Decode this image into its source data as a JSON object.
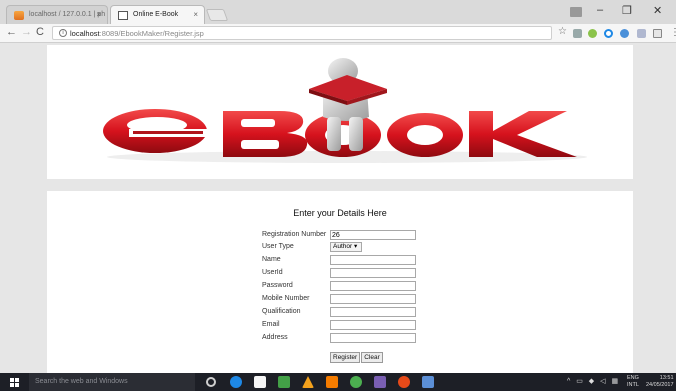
{
  "browser": {
    "tabs": [
      {
        "title": "localhost / 127.0.0.1 | ph"
      },
      {
        "title": "Online E-Book"
      }
    ],
    "tab_close": "×",
    "address_bar": {
      "host": "localhost",
      "path": ":8089/EbookMaker/Register.jsp"
    },
    "nav": {
      "back": "←",
      "forward": "→",
      "reload": "C"
    },
    "window_controls": {
      "minimize": "–",
      "maximize": "❐",
      "close": "✕"
    }
  },
  "banner": {
    "logo_text": "eBOOK",
    "colors": {
      "brand_red": "#d6121d",
      "reader_red": "#c8202a"
    }
  },
  "form": {
    "title": "Enter your Details Here",
    "fields": [
      {
        "label": "Registration Number",
        "value": "26"
      },
      {
        "label": "User Type",
        "value": "Author"
      },
      {
        "label": "Name",
        "value": ""
      },
      {
        "label": "UserId",
        "value": ""
      },
      {
        "label": "Password",
        "value": ""
      },
      {
        "label": "Mobile Number",
        "value": ""
      },
      {
        "label": "Qualification",
        "value": ""
      },
      {
        "label": "Email",
        "value": ""
      },
      {
        "label": "Address",
        "value": ""
      }
    ],
    "select_arrow": "▾",
    "buttons": {
      "register": "Register",
      "clear": "Clear"
    }
  },
  "taskbar": {
    "search_placeholder": "Search the web and Windows",
    "language": "ENG",
    "language_sub": "INTL",
    "time": "13:51",
    "date": "24/05/2017"
  }
}
